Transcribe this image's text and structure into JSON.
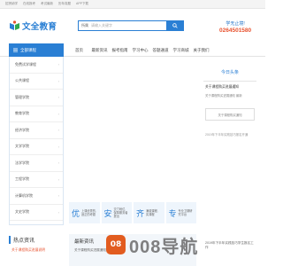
{
  "topbar": {
    "links": [
      "招贤纳学",
      "在线报考",
      "考试最新",
      "历年真题",
      "APP下载"
    ]
  },
  "logo": {
    "text": "文全教育"
  },
  "search": {
    "category": "所属",
    "placeholder": "请输入关键字"
  },
  "hotline": {
    "label": "学无止境!",
    "number": "0264501580"
  },
  "nav": {
    "category_label": "全部课程",
    "items": [
      "首页",
      "最新资讯",
      "报考指南",
      "学习中心",
      "答题通道",
      "学习商城",
      "关于我们"
    ]
  },
  "sidebar": {
    "items": [
      "免费试学课程",
      "公共课程",
      "管理学院",
      "教育学院",
      "经济学院",
      "文学学院",
      "法学学院",
      "工程学院",
      "计算机学院",
      "文史学院"
    ]
  },
  "features": [
    {
      "icon": "优",
      "text": "上课优秀的, 适正的考题"
    },
    {
      "icon": "安",
      "text": "交门地位, 保障服务者提出"
    },
    {
      "icon": "齐",
      "text": "满载课程, 实课程"
    },
    {
      "icon": "专",
      "text": "专业卫期研究平台"
    }
  ],
  "right_col": {
    "title": "今日头条",
    "link": "关于课程购买进展通知",
    "sub": "关于课程购买进展通知 最新",
    "box": "关于课程购买通知",
    "date": "2019年下半年实践技巧报名开通"
  },
  "hot": {
    "title": "热点资讯",
    "link": "关于课程购买进展说明"
  },
  "news": {
    "title": "最新资讯",
    "sub": "关于课程购买进展通知 最新"
  },
  "news_side": {
    "text": "2019年下半年实践技巧学生报名工作"
  },
  "watermark": {
    "logo": "08",
    "text": "008导航"
  }
}
